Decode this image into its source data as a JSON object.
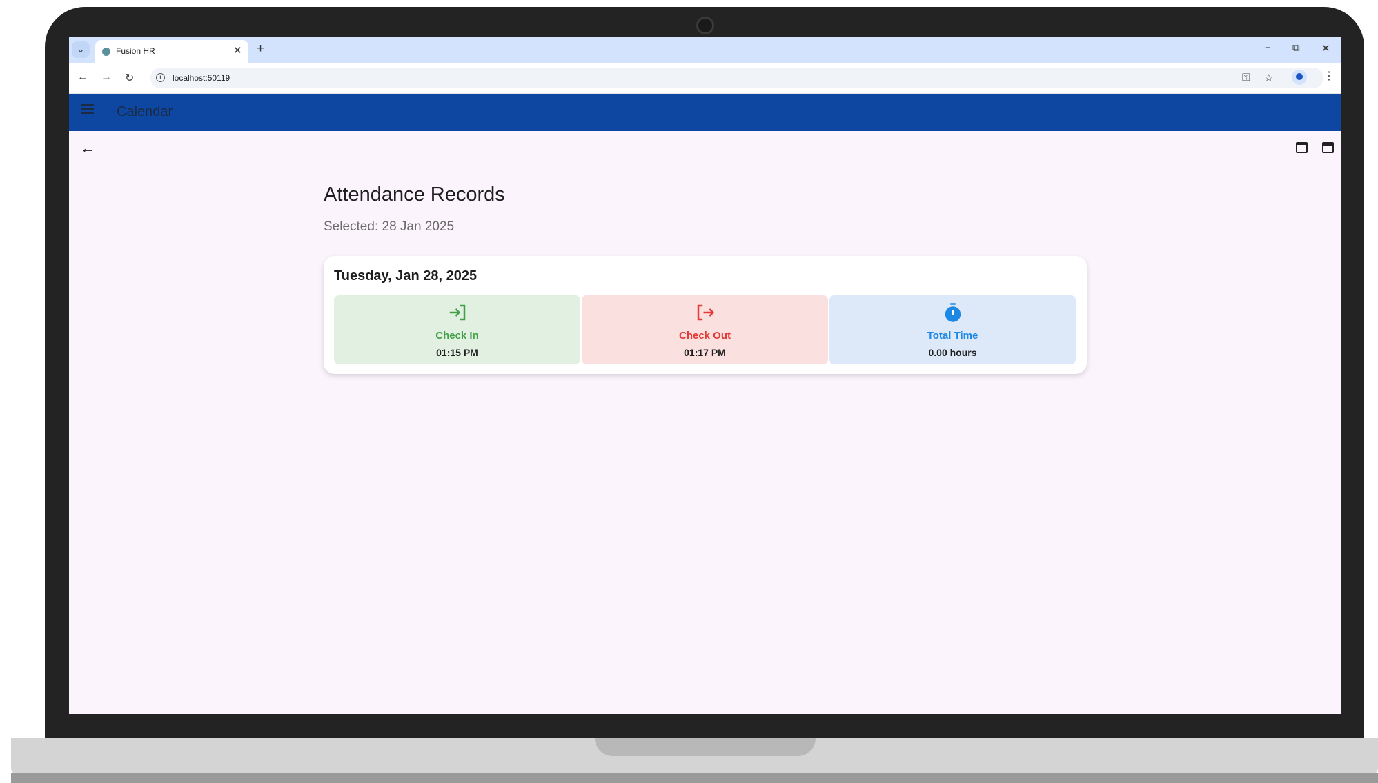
{
  "browser": {
    "tab_title": "Fusion HR",
    "url": "localhost:50119"
  },
  "app_bar": {
    "title": "Calendar"
  },
  "page": {
    "title": "Attendance Records",
    "selected_label": "Selected: 28 Jan 2025"
  },
  "record": {
    "date": "Tuesday, Jan 28, 2025",
    "check_in": {
      "label": "Check In",
      "value": "01:15 PM",
      "color": "#43a047",
      "bg": "#e1f0e1"
    },
    "check_out": {
      "label": "Check Out",
      "value": "01:17 PM",
      "color": "#e53935",
      "bg": "#fbe0e0"
    },
    "total_time": {
      "label": "Total Time",
      "value": "0.00 hours",
      "color": "#1e88e5",
      "bg": "#dde9f8"
    }
  },
  "icons": {
    "check_in": "login-icon",
    "check_out": "logout-icon",
    "total_time": "timer-icon"
  }
}
